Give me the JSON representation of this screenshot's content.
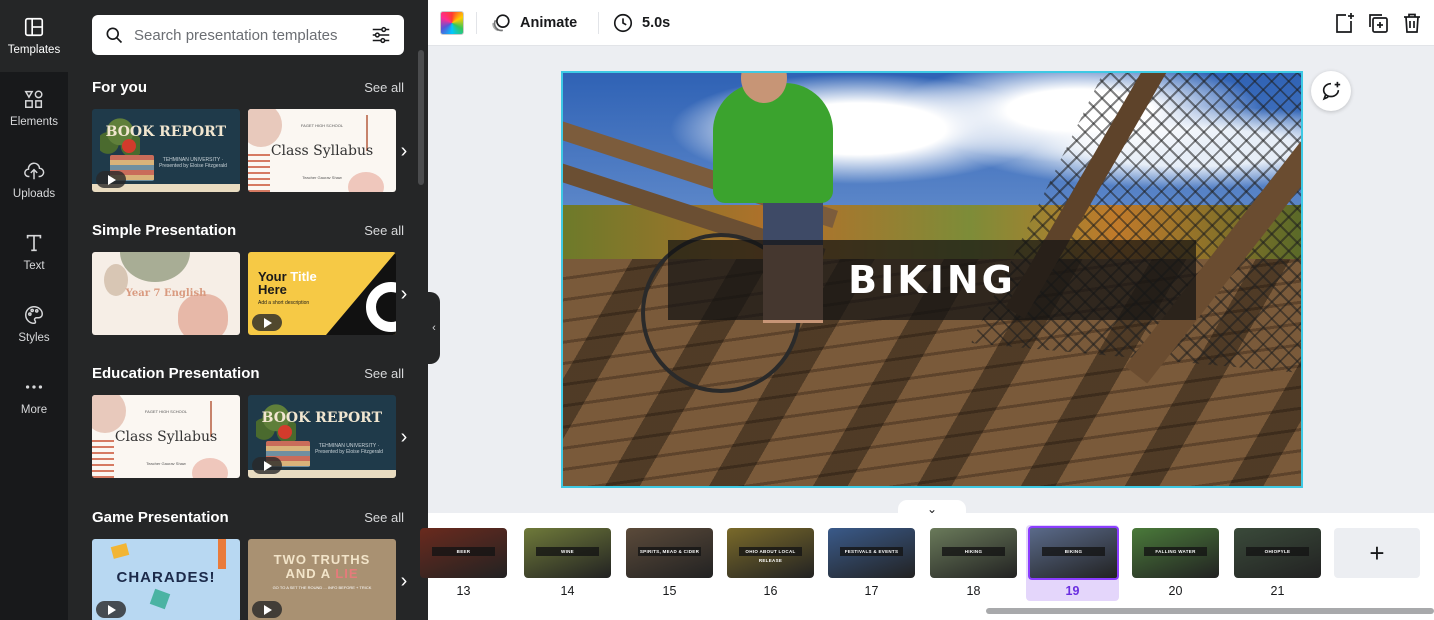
{
  "rail": {
    "items": [
      {
        "label": "Templates",
        "icon": "templates-icon",
        "active": true
      },
      {
        "label": "Elements",
        "icon": "elements-icon"
      },
      {
        "label": "Uploads",
        "icon": "uploads-icon"
      },
      {
        "label": "Text",
        "icon": "text-icon"
      },
      {
        "label": "Styles",
        "icon": "styles-icon"
      },
      {
        "label": "More",
        "icon": "more-icon"
      }
    ]
  },
  "search": {
    "placeholder": "Search presentation templates"
  },
  "sections": [
    {
      "title": "For you",
      "see_all": "See all",
      "thumbs": [
        {
          "kind": "book-report",
          "text": "BOOK REPORT",
          "sub": "TEHMINAN UNIVERSITY · Presented by Eloise Fitzgerald"
        },
        {
          "kind": "syllabus",
          "text": "Class Syllabus",
          "top": "FAGET HIGH SCHOOL",
          "bottom": "Teacher Gaurav Shaw"
        }
      ]
    },
    {
      "title": "Simple Presentation",
      "see_all": "See all",
      "thumbs": [
        {
          "kind": "year7",
          "text": "Year 7 English"
        },
        {
          "kind": "yourtitle",
          "line1": "Your",
          "line1b": "Title",
          "line2": "Here",
          "sub": "Add a short description"
        }
      ]
    },
    {
      "title": "Education Presentation",
      "see_all": "See all",
      "thumbs": [
        {
          "kind": "syllabus",
          "text": "Class Syllabus",
          "top": "FAGET HIGH SCHOOL",
          "bottom": "Teacher Gaurav Shaw"
        },
        {
          "kind": "book-report",
          "text": "BOOK REPORT",
          "sub": "TEHMINAN UNIVERSITY · Presented by Eloise Fitzgerald"
        }
      ]
    },
    {
      "title": "Game Presentation",
      "see_all": "See all",
      "thumbs": [
        {
          "kind": "charades",
          "text": "CHARADES!"
        },
        {
          "kind": "twotruths",
          "line1": "TWO TRUTHS",
          "line2a": "AND A ",
          "line2b": "LIE",
          "sub": "GO TO A SET THE ROUND ... INFO BEFORE + TRICK"
        }
      ]
    }
  ],
  "toolbar": {
    "animate_label": "Animate",
    "duration_label": "5.0s",
    "icons": [
      "color-swatch-icon",
      "animate-icon",
      "timer-icon",
      "add-page-icon",
      "duplicate-page-icon",
      "delete-icon"
    ]
  },
  "slide": {
    "title": "BIKING"
  },
  "filmstrip": {
    "pages": [
      {
        "num": "13",
        "label": "BEER",
        "bg": "#6a2a1e"
      },
      {
        "num": "14",
        "label": "WINE",
        "bg": "#6f7a3a"
      },
      {
        "num": "15",
        "label": "SPIRITS, MEAD & CIDER",
        "bg": "#5b4a3a"
      },
      {
        "num": "16",
        "label": "OHIO ABOUT LOCAL RELEASE",
        "bg": "#7a6a2a"
      },
      {
        "num": "17",
        "label": "FESTIVALS & EVENTS",
        "bg": "#3a5a8a"
      },
      {
        "num": "18",
        "label": "HIKING",
        "bg": "#6a7a5a"
      },
      {
        "num": "19",
        "label": "BIKING",
        "bg": "#5a6a8a",
        "active": true
      },
      {
        "num": "20",
        "label": "FALLING WATER",
        "bg": "#4a7a3a"
      },
      {
        "num": "21",
        "label": "OHIOPYLE",
        "bg": "#3a4a3a"
      }
    ],
    "add_label": "+"
  },
  "colors": {
    "selection": "#3ec9e4",
    "active_page": "#8b3dff",
    "active_page_bg": "#e4d6fb",
    "rail_bg": "#18191b",
    "panel_bg": "#252627"
  }
}
